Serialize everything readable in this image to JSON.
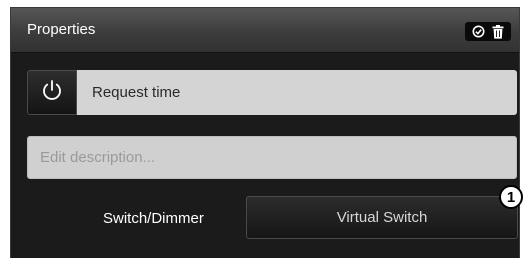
{
  "header": {
    "title": "Properties",
    "icons": [
      "check-circle-icon",
      "trash-icon"
    ]
  },
  "request": {
    "icon": "power-icon",
    "label": "Request time"
  },
  "description": {
    "value": "",
    "placeholder": "Edit description..."
  },
  "device_type": {
    "label": "Switch/Dimmer",
    "selected": "Virtual Switch"
  },
  "callout": {
    "number": "1"
  },
  "colors": {
    "panel_bg": "#1b1b1b",
    "header_bg": "#3c3c3c",
    "field_bg": "#d4d4d4",
    "text_light": "#ffffff"
  }
}
